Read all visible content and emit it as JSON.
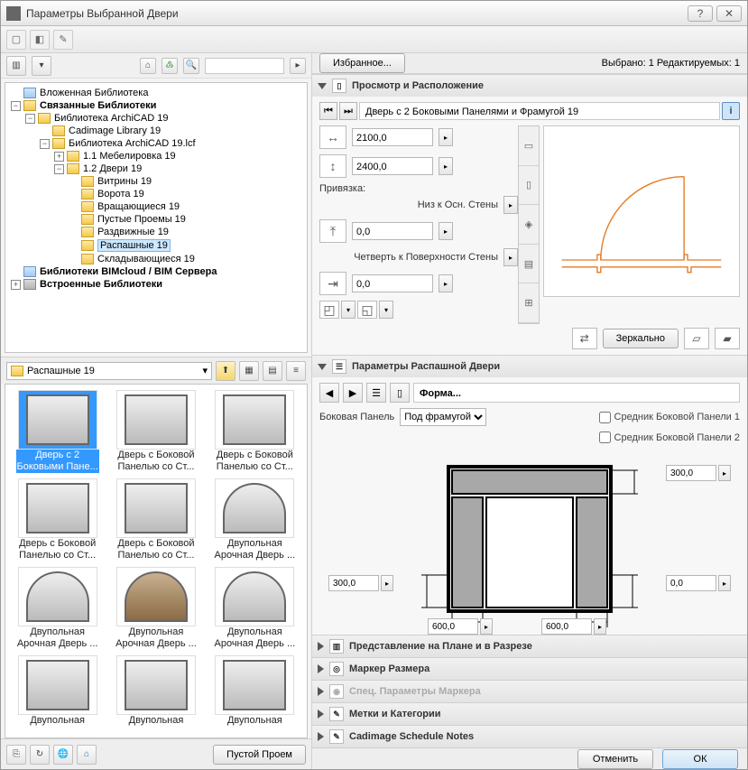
{
  "window": {
    "title": "Параметры Выбранной Двери"
  },
  "topright": {
    "selected": "Выбрано: 1 Редактируемых: 1",
    "favorites": "Избранное..."
  },
  "tree": {
    "root0": "Вложенная Библиотека",
    "linked": "Связанные Библиотеки",
    "lib19": "Библиотека ArchiCAD 19",
    "cadimage": "Cadimage Library 19",
    "lcf": "Библиотека ArchiCAD 19.lcf",
    "meb": "1.1 Мебелировка 19",
    "doors": "1.2 Двери 19",
    "d1": "Витрины 19",
    "d2": "Ворота 19",
    "d3": "Вращающиеся 19",
    "d4": "Пустые Проемы 19",
    "d5": "Раздвижные 19",
    "d6": "Распашные 19",
    "d7": "Складывающиеся 19",
    "bim": "Библиотеки BIMcloud / BIM Сервера",
    "emb": "Встроенные Библиотеки"
  },
  "folder": {
    "current": "Распашные 19"
  },
  "thumbs": {
    "t1a": "Дверь с 2",
    "t1b": "Боковыми Пане...",
    "t2a": "Дверь с Боковой",
    "t2b": "Панелью со Ст...",
    "t3a": "Дверь с Боковой",
    "t3b": "Панелью со Ст...",
    "t4a": "Дверь с Боковой",
    "t4b": "Панелью со Ст...",
    "t5a": "Дверь с Боковой",
    "t5b": "Панелью со Ст...",
    "t6a": "Двупольная",
    "t6b": "Арочная Дверь ...",
    "t7a": "Двупольная",
    "t7b": "Арочная Дверь ...",
    "t8a": "Двупольная",
    "t8b": "Арочная Дверь ...",
    "t9a": "Двупольная",
    "t9b": "Арочная Дверь ...",
    "t10a": "Двупольная",
    "t10b": "",
    "t11a": "Двупольная",
    "t11b": "",
    "t12a": "Двупольная",
    "t12b": ""
  },
  "leftbottom": {
    "empty": "Пустой Проем"
  },
  "sec1": {
    "title": "Просмотр и Расположение",
    "obj": "Дверь с 2 Боковыми Панелями и Фрамугой 19",
    "width": "2100,0",
    "height": "2400,0",
    "anchorLbl": "Привязка:",
    "anchorOpt": "Низ к Осн. Стены",
    "anchorVal": "0,0",
    "revealLbl": "Четверть к Поверхности Стены",
    "revealVal": "0,0",
    "mirror": "Зеркально"
  },
  "sec2": {
    "title": "Параметры Распашной Двери",
    "form": "Форма...",
    "sidePanelLbl": "Боковая Панель",
    "sidePanelVal": "Под фрамугой",
    "mullion1": "Средник Боковой Панели 1",
    "mullion2": "Средник Боковой Панели 2",
    "top": "300,0",
    "left": "300,0",
    "right": "0,0",
    "bl": "600,0",
    "br": "600,0"
  },
  "sections": {
    "plan": "Представление на Плане и в Разрезе",
    "marker": "Маркер Размера",
    "special": "Спец. Параметры Маркера",
    "tags": "Метки и Категории",
    "cadimage": "Cadimage Schedule Notes"
  },
  "buttons": {
    "cancel": "Отменить",
    "ok": "ОК"
  }
}
